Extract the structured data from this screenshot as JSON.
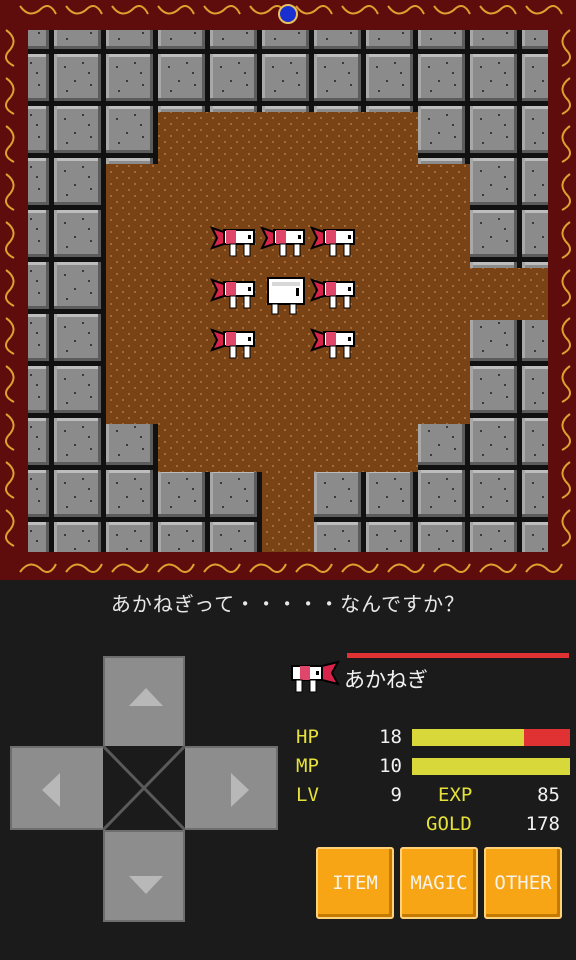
{
  "message": "あかねぎって・・・・・なんですか？",
  "enemy": {
    "name": "あかねぎ",
    "hp_fraction": 1.0
  },
  "stats": {
    "hp_label": "HP",
    "hp_value": "18",
    "hp_fraction": 0.71,
    "mp_label": "MP",
    "mp_value": "10",
    "mp_fraction": 1.0,
    "lv_label": "LV",
    "lv_value": "9",
    "exp_label": "EXP",
    "exp_value": "85",
    "gold_label": "GOLD",
    "gold_value": "178"
  },
  "commands": {
    "item": "ITEM",
    "magic": "MAGIC",
    "other": "OTHER"
  },
  "dpad": {
    "up": "arrow-up-icon",
    "down": "arrow-down-icon",
    "left": "arrow-left-icon",
    "right": "arrow-right-icon"
  },
  "colors": {
    "floor": "#7a4316",
    "wall": "#8b8b8b",
    "hp_bar": "#d9d83a",
    "damage": "#e03232",
    "button": "#f8a515",
    "label": "#e6e13a"
  }
}
